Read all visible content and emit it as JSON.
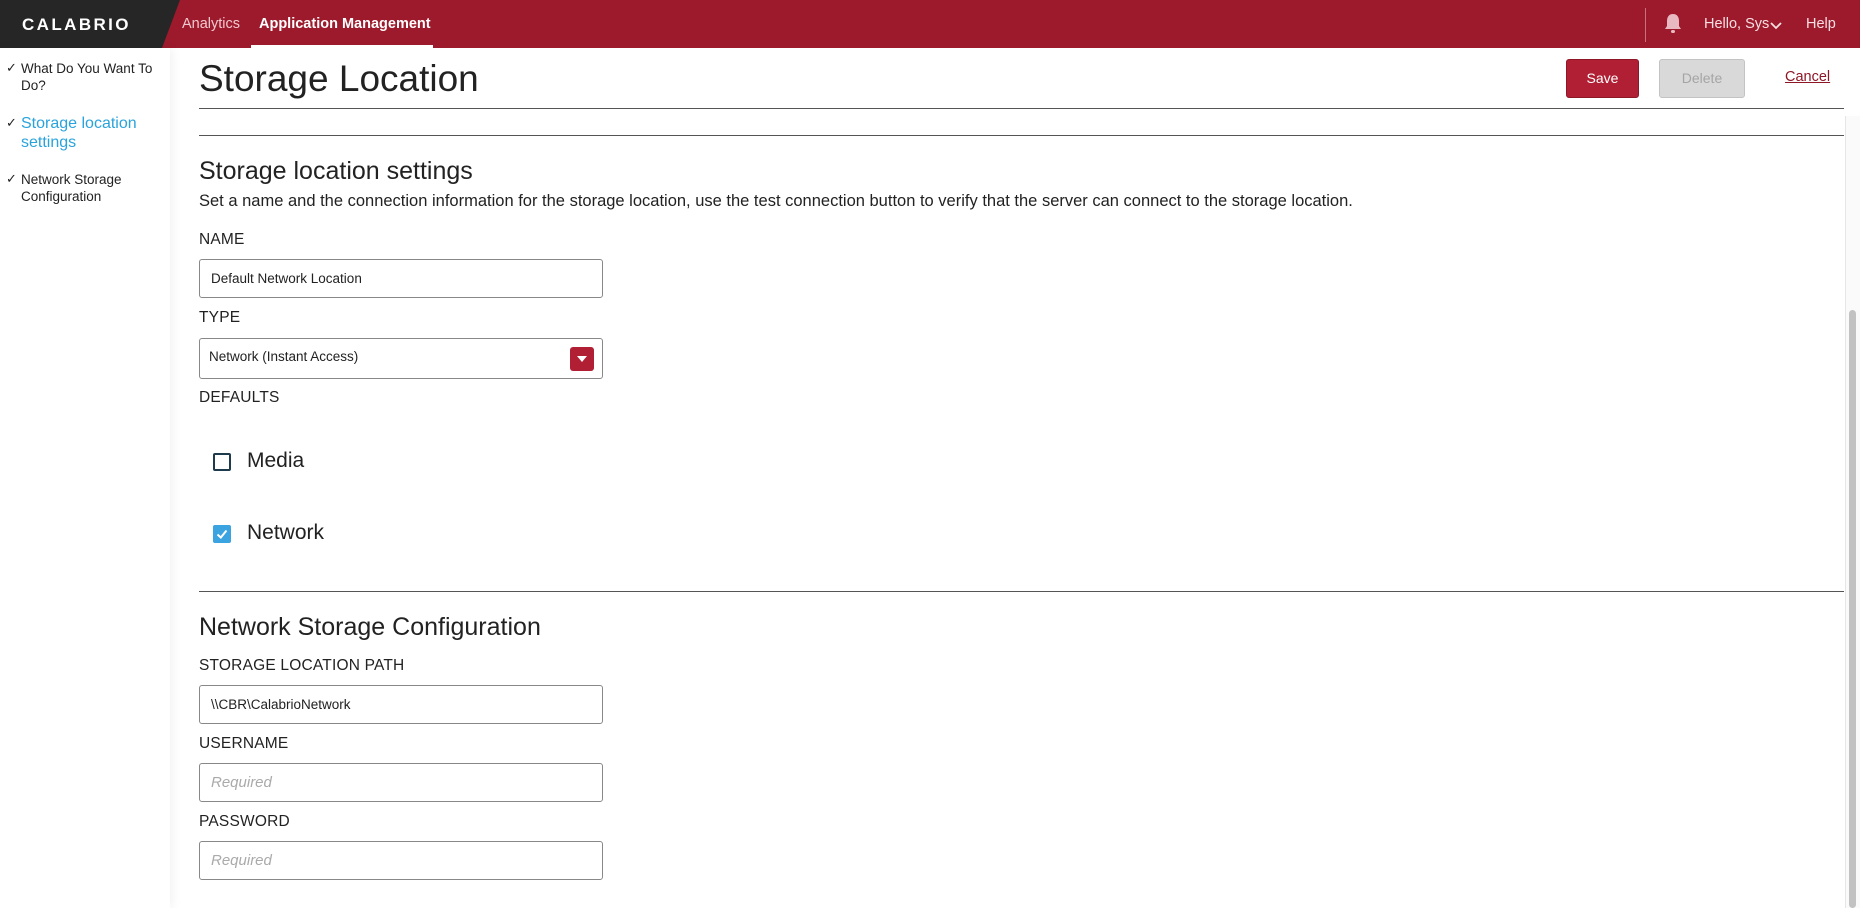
{
  "brand": {
    "logo_text": "CALABRIO",
    "accent_color": "#9d1a2c",
    "link_color": "#2aa3dc"
  },
  "topnav": {
    "items": [
      {
        "label": "Analytics",
        "active": false
      },
      {
        "label": "Application Management",
        "active": true
      }
    ],
    "notifications_icon": "bell-icon",
    "user_label": "Hello, Sys",
    "help_label": "Help"
  },
  "wizard": {
    "steps": [
      {
        "label": "What Do You Want To Do?",
        "checked": true,
        "active": false
      },
      {
        "label": "Storage location settings",
        "checked": true,
        "active": true
      },
      {
        "label": "Network Storage Configuration",
        "checked": true,
        "active": false
      }
    ]
  },
  "header": {
    "title": "Storage Location",
    "save_label": "Save",
    "delete_label": "Delete",
    "delete_disabled": true,
    "cancel_label": "Cancel"
  },
  "settings": {
    "title": "Storage location settings",
    "description": "Set a name and the connection information for the storage location, use the test connection button to verify that the server can connect to the storage location.",
    "name_label": "NAME",
    "name_value": "Default Network Location",
    "type_label": "TYPE",
    "type_value": "Network (Instant Access)",
    "defaults_label": "DEFAULTS",
    "defaults": [
      {
        "label": "Media",
        "checked": false
      },
      {
        "label": "Network",
        "checked": true
      }
    ]
  },
  "network": {
    "title": "Network Storage Configuration",
    "path_label": "STORAGE LOCATION PATH",
    "path_value": "\\\\CBR\\CalabrioNetwork",
    "username_label": "USERNAME",
    "username_placeholder": "Required",
    "username_value": "",
    "password_label": "PASSWORD",
    "password_placeholder": "Required",
    "password_value": ""
  }
}
